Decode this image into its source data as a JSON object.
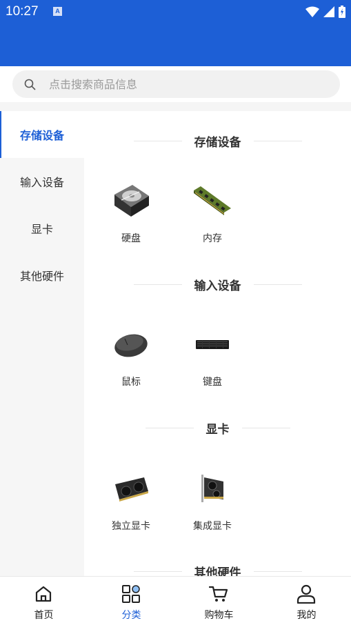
{
  "status_bar": {
    "time": "10:27",
    "notification_badge": "A"
  },
  "search": {
    "placeholder": "点击搜索商品信息"
  },
  "sidebar": {
    "items": [
      {
        "label": "存储设备",
        "active": true
      },
      {
        "label": "输入设备",
        "active": false
      },
      {
        "label": "显卡",
        "active": false
      },
      {
        "label": "其他硬件",
        "active": false
      }
    ]
  },
  "sections": [
    {
      "title": "存储设备",
      "products": [
        {
          "name": "硬盘",
          "icon": "hard-drive-icon"
        },
        {
          "name": "内存",
          "icon": "ram-icon"
        }
      ]
    },
    {
      "title": "输入设备",
      "products": [
        {
          "name": "鼠标",
          "icon": "mouse-icon"
        },
        {
          "name": "键盘",
          "icon": "keyboard-icon"
        }
      ]
    },
    {
      "title": "显卡",
      "products": [
        {
          "name": "独立显卡",
          "icon": "graphics-card-icon"
        },
        {
          "name": "集成显卡",
          "icon": "graphics-card-icon"
        }
      ]
    },
    {
      "title": "其他硬件",
      "products": []
    }
  ],
  "tabbar": {
    "tabs": [
      {
        "label": "首页",
        "icon": "home-icon",
        "active": false
      },
      {
        "label": "分类",
        "icon": "category-icon",
        "active": true
      },
      {
        "label": "购物车",
        "icon": "cart-icon",
        "active": false
      },
      {
        "label": "我的",
        "icon": "user-icon",
        "active": false
      }
    ]
  },
  "colors": {
    "primary": "#1d5fd6",
    "sidebar_bg": "#f6f6f6",
    "search_bg": "#f1f1f1",
    "text": "#333333"
  }
}
